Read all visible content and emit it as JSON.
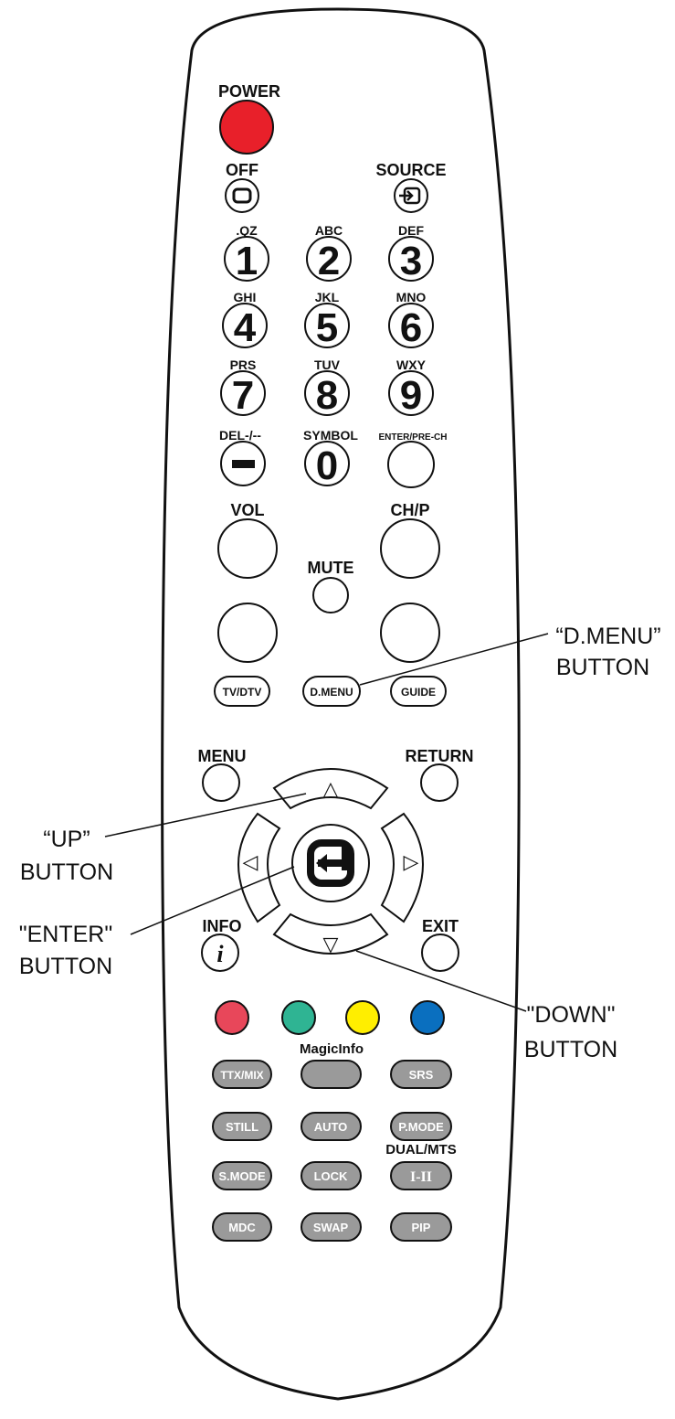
{
  "top": {
    "power_label": "POWER",
    "off_label": "OFF",
    "source_label": "SOURCE"
  },
  "numpad": {
    "keys": [
      {
        "sub": ".QZ",
        "digit": "1"
      },
      {
        "sub": "ABC",
        "digit": "2"
      },
      {
        "sub": "DEF",
        "digit": "3"
      },
      {
        "sub": "GHI",
        "digit": "4"
      },
      {
        "sub": "JKL",
        "digit": "5"
      },
      {
        "sub": "MNO",
        "digit": "6"
      },
      {
        "sub": "PRS",
        "digit": "7"
      },
      {
        "sub": "TUV",
        "digit": "8"
      },
      {
        "sub": "WXY",
        "digit": "9"
      }
    ],
    "del_label": "DEL-/--",
    "symbol_label": "SYMBOL",
    "zero": "0",
    "enter_prech_label": "ENTER/PRE-CH"
  },
  "volume": {
    "vol_label": "VOL",
    "ch_label": "CH/P",
    "mute_label": "MUTE"
  },
  "middle": {
    "tvdtv": "TV/DTV",
    "dmenu": "D.MENU",
    "guide": "GUIDE",
    "menu_label": "MENU",
    "return_label": "RETURN",
    "info_label": "INFO",
    "info_glyph": "i",
    "exit_label": "EXIT"
  },
  "arrows": {
    "up": "△",
    "down": "▽",
    "left": "◁",
    "right": "▷"
  },
  "color_keys": {
    "red": "#e8475a",
    "green": "#2fb493",
    "yellow": "#ffee00",
    "blue": "#0a6fbf"
  },
  "function_keys": {
    "magicinfo_label": "MagicInfo",
    "ttxmix": "TTX/MIX",
    "srs": "SRS",
    "still": "STILL",
    "auto": "AUTO",
    "pmode": "P.MODE",
    "dual_label": "DUAL/MTS",
    "smode": "S.MODE",
    "lock": "LOCK",
    "i_ii": "I-II",
    "mdc": "MDC",
    "swap": "SWAP",
    "pip": "PIP"
  },
  "callouts": {
    "dmenu_line1": "“D.MENU”",
    "dmenu_line2": "BUTTON",
    "up_line1": "“UP”",
    "up_line2": "BUTTON",
    "enter_line1": "\"ENTER\"",
    "enter_line2": "BUTTON",
    "down_line1": "\"DOWN\"",
    "down_line2": "BUTTON"
  },
  "colors": {
    "power": "#e8202a",
    "gray_button": "#9a9a9a",
    "outline": "#111111"
  }
}
